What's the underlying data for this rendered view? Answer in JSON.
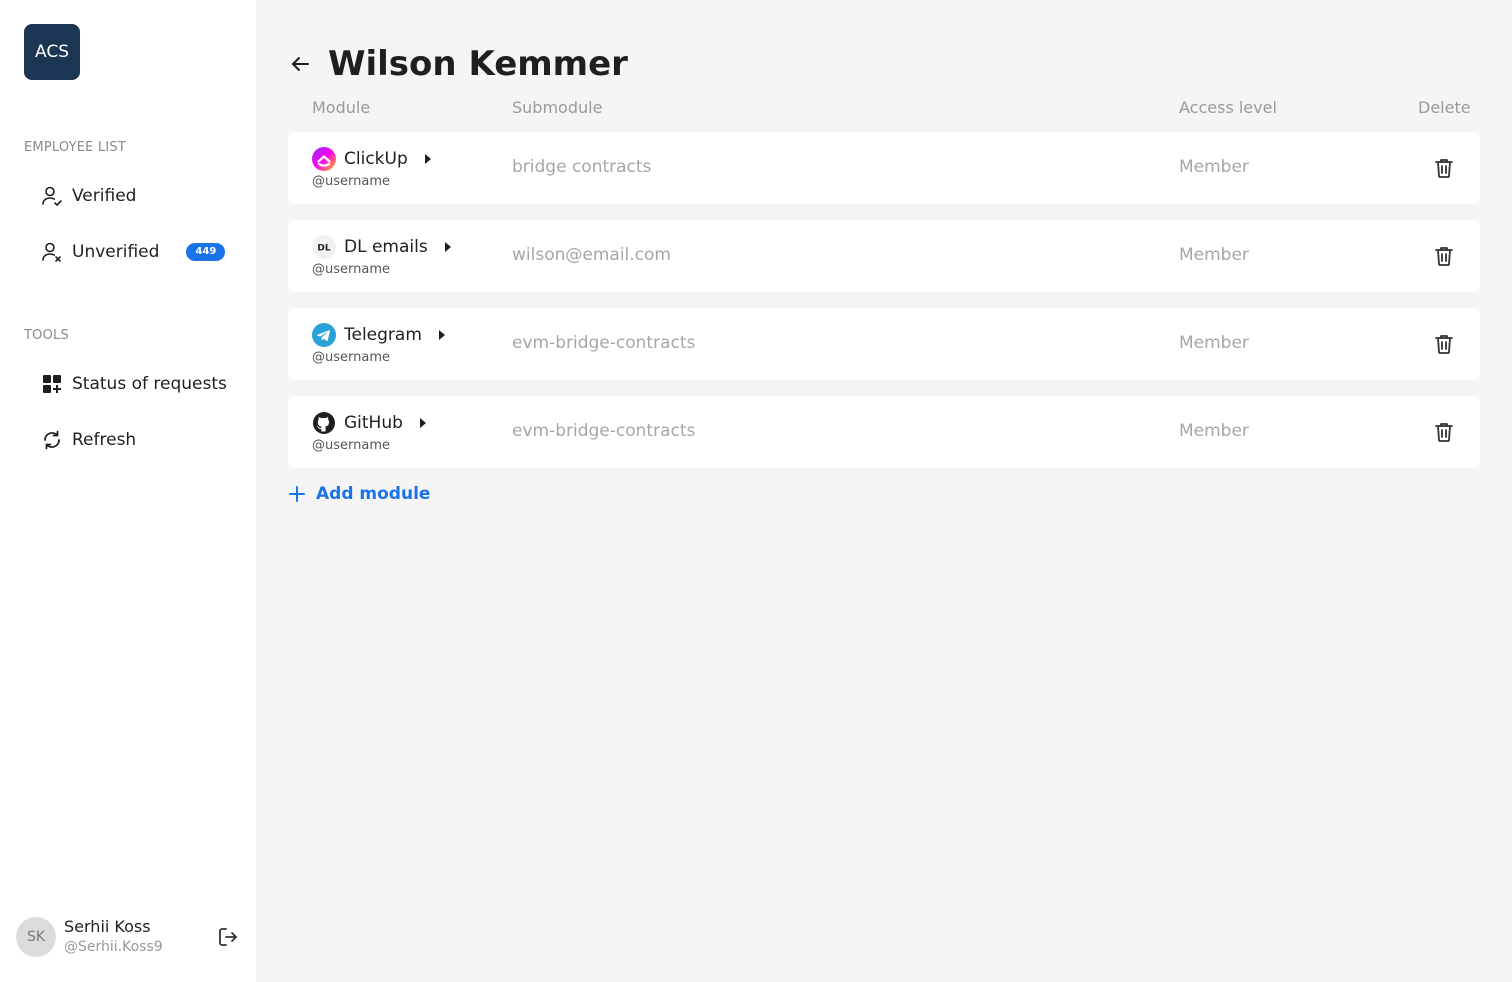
{
  "sidebar": {
    "logo_text": "ACS",
    "employee_section_title": "EMPLOYEE LIST",
    "verified_label": "Verified",
    "unverified_label": "Unverified",
    "unverified_count": "449",
    "tools_section_title": "TOOLS",
    "status_label": "Status of requests",
    "refresh_label": "Refresh"
  },
  "user": {
    "initials": "SK",
    "name": "Serhii Koss",
    "handle": "@Serhii.Koss9"
  },
  "page": {
    "title": "Wilson Kemmer"
  },
  "table": {
    "headers": {
      "module": "Module",
      "submodule": "Submodule",
      "access": "Access level",
      "delete": "Delete"
    },
    "rows": [
      {
        "module": "ClickUp",
        "icon": "clickup-icon",
        "username": "@username",
        "submodule": "bridge contracts",
        "access": "Member"
      },
      {
        "module": "DL emails",
        "icon": "dl-icon",
        "icon_text": "DL",
        "username": "@username",
        "submodule": "wilson@email.com",
        "access": "Member"
      },
      {
        "module": "Telegram",
        "icon": "telegram-icon",
        "username": "@username",
        "submodule": "evm-bridge-contracts",
        "access": "Member"
      },
      {
        "module": "GitHub",
        "icon": "github-icon",
        "username": "@username",
        "submodule": "evm-bridge-contracts",
        "access": "Member"
      }
    ]
  },
  "actions": {
    "add_module_label": "Add module"
  },
  "colors": {
    "accent": "#1a73e8",
    "logo_bg": "#1b3553",
    "telegram": "#2aa1da"
  }
}
